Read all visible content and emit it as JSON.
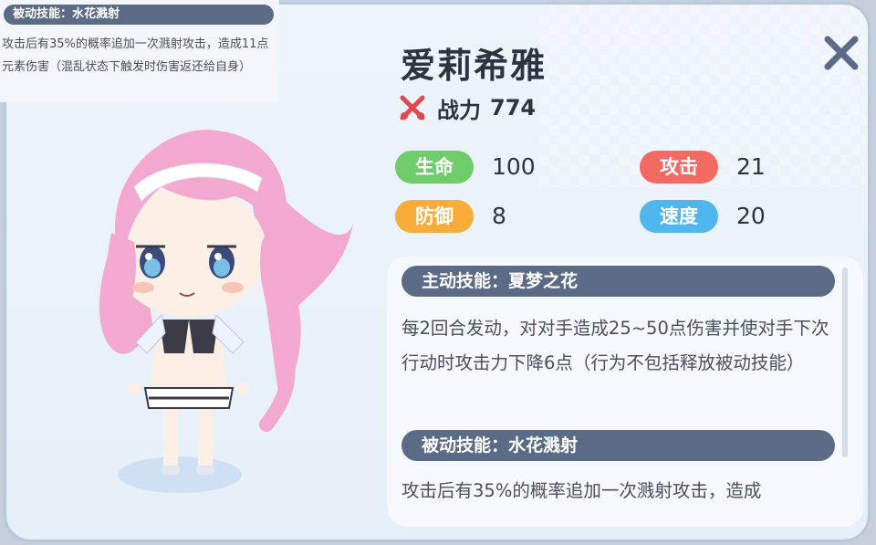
{
  "tooltip": {
    "title": "被动技能：水花溅射",
    "text": "攻击后有35%的概率追加一次溅射攻击，造成11点元素伤害（混乱状态下触发时伤害返还给自身）"
  },
  "character": {
    "name": "爱莉希雅",
    "power_label": "战力",
    "power_value": "774",
    "power_icon": "crossed-swords-icon"
  },
  "stats": [
    {
      "label": "生命",
      "value": "100",
      "color": "#6fcc6a"
    },
    {
      "label": "攻击",
      "value": "21",
      "color": "#f26a62"
    },
    {
      "label": "防御",
      "value": "8",
      "color": "#f8ad3a"
    },
    {
      "label": "速度",
      "value": "20",
      "color": "#4fb7ee"
    }
  ],
  "skills": {
    "active_title": "主动技能：夏梦之花",
    "active_text": "每2回合发动，对对手造成25~50点伤害并使对手下次行动时攻击力下降6点（行为不包括释放被动技能）",
    "passive_title": "被动技能：水花溅射",
    "passive_text": "攻击后有35%的概率追加一次溅射攻击，造成"
  },
  "colors": {
    "panel_bar": "#5b6a85",
    "close": "#5b6a85",
    "hair": "#f3a8cf"
  }
}
